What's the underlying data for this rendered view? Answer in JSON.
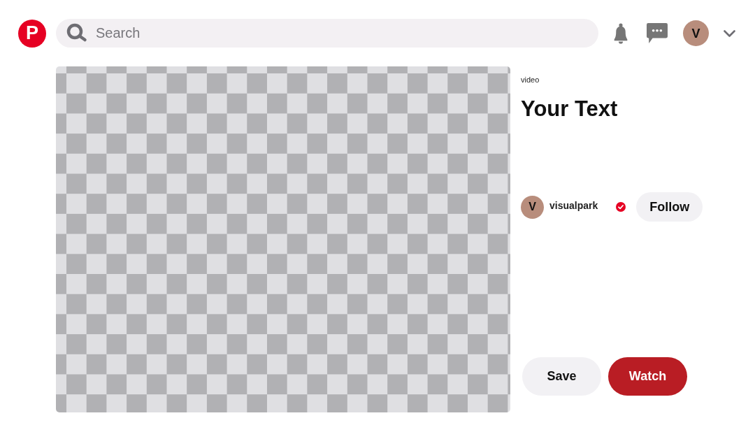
{
  "header": {
    "logo_letter": "P",
    "search": {
      "placeholder": "Search"
    },
    "avatar_letter": "V"
  },
  "pin": {
    "category": "video",
    "title": "Your Text",
    "creator": {
      "avatar_letter": "V",
      "name": "visualpark",
      "verified": true
    },
    "follow_button": "Follow",
    "actions": [
      {
        "label": "Save",
        "kind": "secondary"
      },
      {
        "label": "Watch",
        "kind": "primary"
      }
    ]
  }
}
